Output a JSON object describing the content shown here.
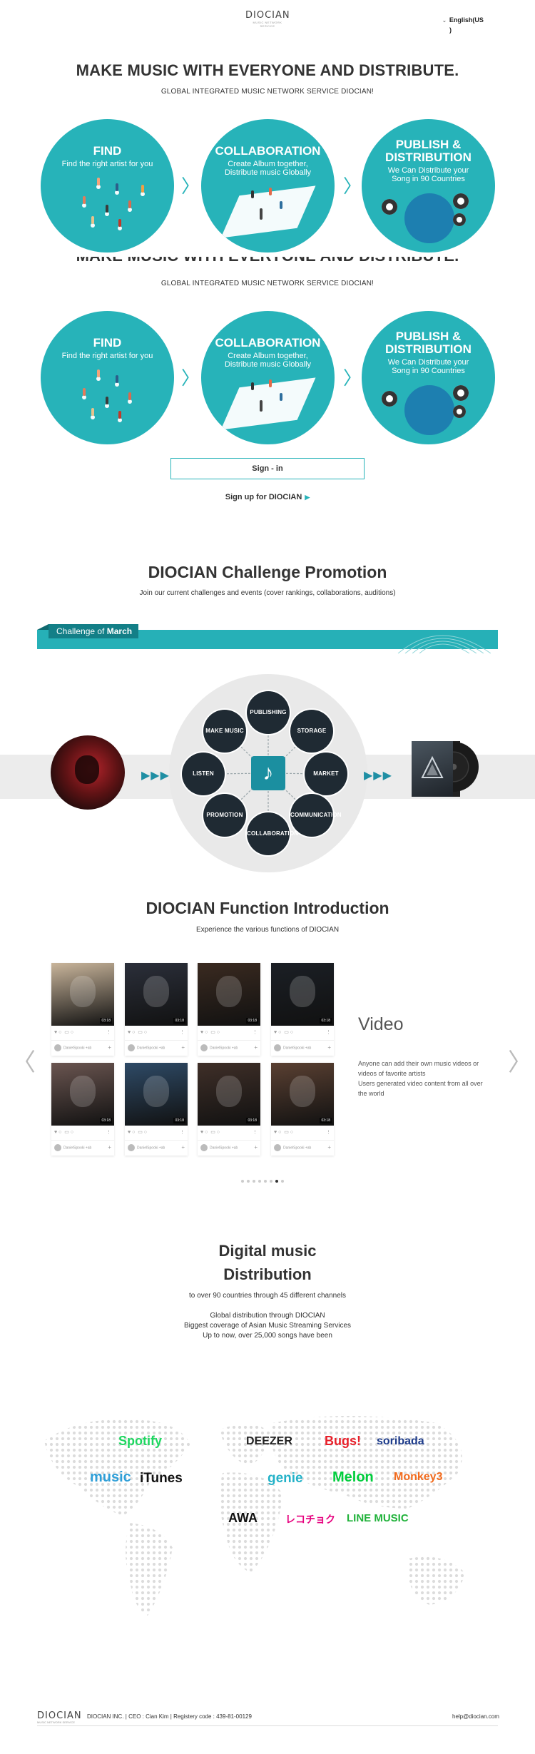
{
  "header": {
    "logo_name": "DIOCIAN",
    "logo_tag": "MUSIC NETWORK SERVICE",
    "lang_line1": "English(US",
    "lang_line2": ")"
  },
  "hero": {
    "title": "MAKE MUSIC WITH EVERYONE AND DISTRIBUTE.",
    "subtitle": "GLOBAL INTEGRATED MUSIC NETWORK SERVICE DIOCIAN!",
    "circles": [
      {
        "title_l1": "FIND",
        "title_l2": "",
        "sub_l1": "Find the right artist for you",
        "sub_l2": ""
      },
      {
        "title_l1": "COLLABORATION",
        "title_l2": "",
        "sub_l1": "Create Album together,",
        "sub_l2": "Distribute music Globally"
      },
      {
        "title_l1": "PUBLISH &",
        "title_l2": "DISTRIBUTION",
        "sub_l1": "We Can Distribute your",
        "sub_l2": "Song in 90 Countries"
      }
    ],
    "arrow": "〉"
  },
  "auth": {
    "signin_label": "Sign - in",
    "signup_label": "Sign up for DIOCIAN",
    "signup_arrow": "▶"
  },
  "challenge": {
    "title": "DIOCIAN Challenge Promotion",
    "subtitle": "Join our current challenges and events (cover rankings, collaborations, auditions)",
    "banner_prefix": "Challenge of",
    "banner_month": "March"
  },
  "hub": {
    "center_icon": "music-note-icon",
    "center_glyph": "♪",
    "triangles": "▶▶▶",
    "nodes": [
      "PUBLISHING",
      "STORAGE",
      "MARKET",
      "COMMUNICATION",
      "COLLABORATION",
      "PROMOTION",
      "LISTEN",
      "MAKE MUSIC"
    ]
  },
  "functions": {
    "title": "DIOCIAN Function Introduction",
    "subtitle": "Experience the various functions of DIOCIAN",
    "video_title": "Video",
    "video_desc_l1": "Anyone can add their own music videos or",
    "video_desc_l2": "videos of favorite artists",
    "video_desc_l3": "Users generated video content from all over",
    "video_desc_l4": "the world",
    "prev_arrow": "〈",
    "next_arrow": "〉",
    "card_duration": "03:18",
    "card_user": "DanielSpooki +ab",
    "card_like": "♥",
    "card_more": "⋮",
    "card_add": "+",
    "card_colors": [
      "#c9b59b",
      "#2b2f3a",
      "#3a2a20",
      "#1b1f25",
      "#6a5550",
      "#2e4a66",
      "#3f2f28",
      "#5a4032"
    ],
    "active_dot": 6,
    "dot_count": 8
  },
  "distribution": {
    "title_l1": "Digital music",
    "title_l2": "Distribution",
    "lead": "to over 90 countries through 45 different channels",
    "line1": "Global distribution through DIOCIAN",
    "line2": "Biggest coverage of Asian Music Streaming Services",
    "line3": "Up to now, over 25,000 songs have been",
    "brands": [
      {
        "name": "Spotify",
        "color": "#1ed760"
      },
      {
        "name": "DEEZER",
        "color": "#222222"
      },
      {
        "name": "Bugs!",
        "color": "#e8202a"
      },
      {
        "name": "soribada",
        "color": "#1d3b8a"
      },
      {
        "name": "music",
        "color": "#2f9fd8"
      },
      {
        "name": "iTunes",
        "color": "#111111"
      },
      {
        "name": "genie",
        "color": "#24b2c8"
      },
      {
        "name": "Melon",
        "color": "#00cd3c"
      },
      {
        "name": "Monkey3",
        "color": "#f26b1d"
      },
      {
        "name": "AWA",
        "color": "#111111"
      },
      {
        "name": "レコチョク",
        "color": "#e6007e"
      },
      {
        "name": "LINE MUSIC",
        "color": "#20b23a"
      }
    ]
  },
  "footer": {
    "logo_name": "DIOCIAN",
    "logo_tag": "MUSIC NETWORK SERVICE",
    "info": "DIOCIAN INC. | CEO : Cian Kim | Registery code : 439-81-00129",
    "email": "help@diocian.com"
  }
}
